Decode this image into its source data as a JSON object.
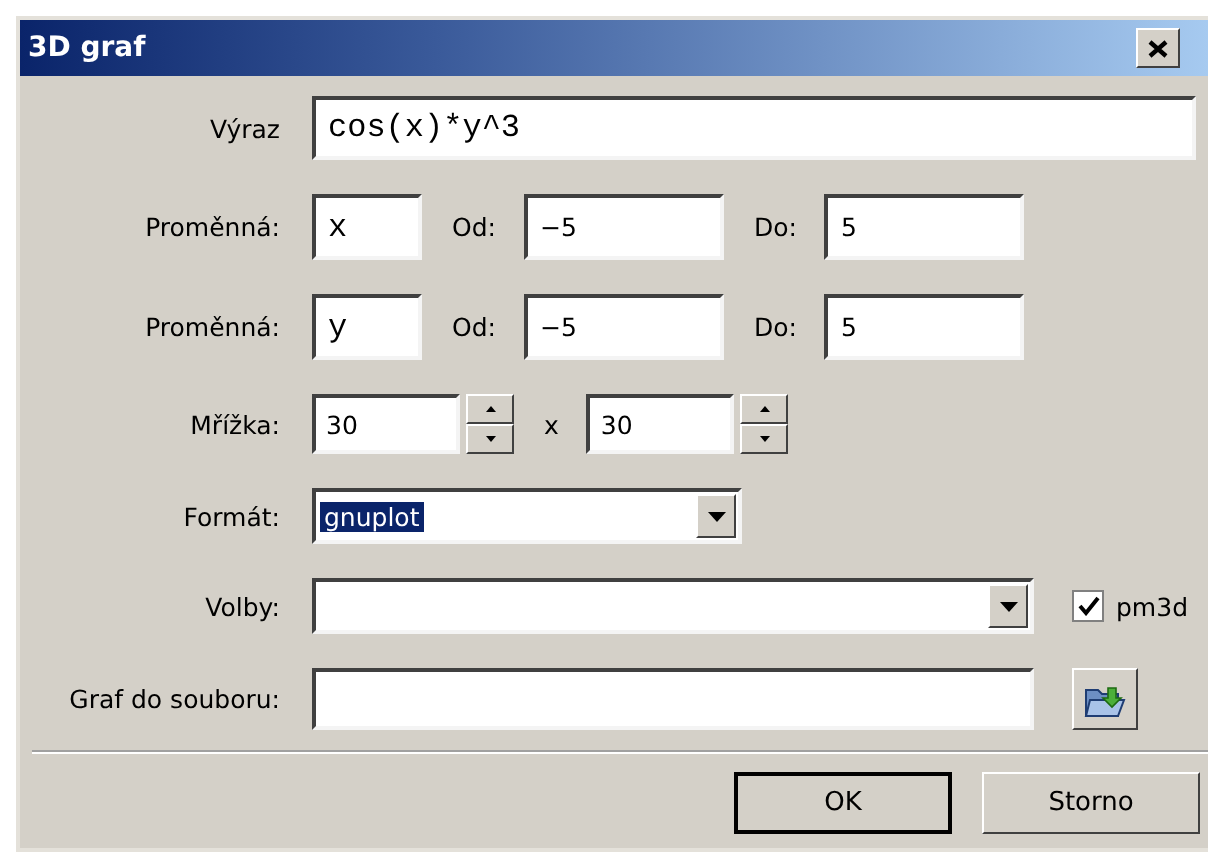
{
  "window": {
    "title": "3D graf"
  },
  "expression": {
    "label": "Výraz",
    "value": "cos(x)*y^3"
  },
  "variables": [
    {
      "label": "Proměnná:",
      "name": "x",
      "from_label": "Od:",
      "from": "−5",
      "to_label": "Do:",
      "to": "5"
    },
    {
      "label": "Proměnná:",
      "name": "y",
      "from_label": "Od:",
      "from": "−5",
      "to_label": "Do:",
      "to": "5"
    }
  ],
  "grid": {
    "label": "Mřížka:",
    "x_value": "30",
    "separator": "x",
    "y_value": "30"
  },
  "format": {
    "label": "Formát:",
    "value": "gnuplot",
    "text_selected": true
  },
  "options": {
    "label": "Volby:",
    "checkbox": {
      "label": "pm3d",
      "checked": true
    }
  },
  "output_file": {
    "label": "Graf do souboru:"
  },
  "buttons": [
    {
      "label": "OK",
      "default": true
    },
    {
      "label": "Storno",
      "default": false
    }
  ]
}
